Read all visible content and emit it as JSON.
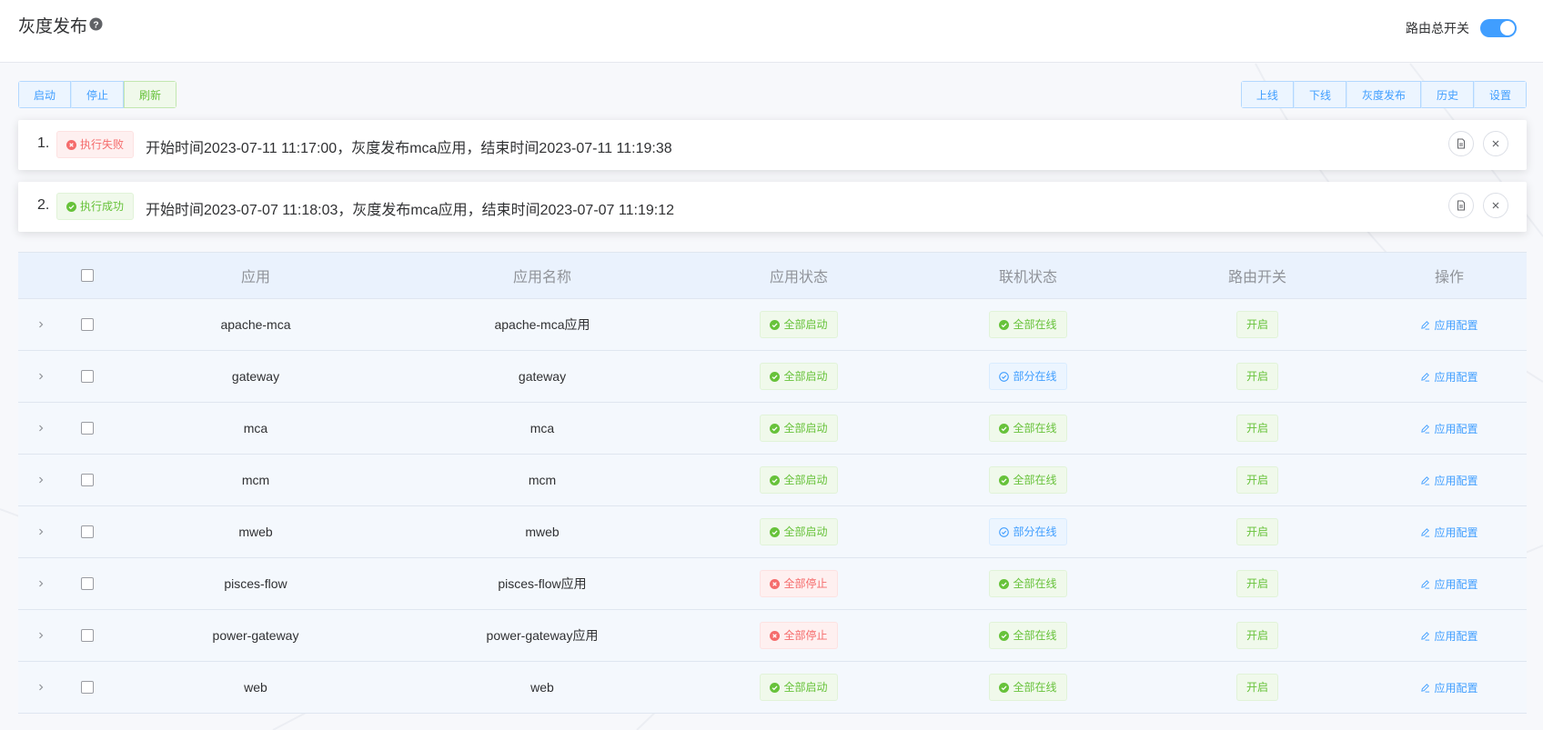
{
  "header": {
    "title": "灰度发布",
    "route_switch_label": "路由总开关",
    "route_switch_on": true
  },
  "toolbar_left": [
    "启动",
    "停止",
    "刷新"
  ],
  "toolbar_right": [
    "上线",
    "下线",
    "灰度发布",
    "历史",
    "设置"
  ],
  "tasks": [
    {
      "index": "1.",
      "status": "执行失败",
      "status_type": "danger",
      "text": "开始时间2023-07-11 11:17:00，灰度发布mca应用，结束时间2023-07-11 11:19:38"
    },
    {
      "index": "2.",
      "status": "执行成功",
      "status_type": "success",
      "text": "开始时间2023-07-07 11:18:03，灰度发布mca应用，结束时间2023-07-07 11:19:12"
    }
  ],
  "table": {
    "columns": [
      "应用",
      "应用名称",
      "应用状态",
      "联机状态",
      "路由开关",
      "操作"
    ],
    "rows": [
      {
        "app": "apache-mca",
        "name": "apache-mca应用",
        "status": "全部启动",
        "status_type": "success",
        "online": "全部在线",
        "online_type": "success",
        "route": "开启",
        "op": "应用配置"
      },
      {
        "app": "gateway",
        "name": "gateway",
        "status": "全部启动",
        "status_type": "success",
        "online": "部分在线",
        "online_type": "info",
        "route": "开启",
        "op": "应用配置"
      },
      {
        "app": "mca",
        "name": "mca",
        "status": "全部启动",
        "status_type": "success",
        "online": "全部在线",
        "online_type": "success",
        "route": "开启",
        "op": "应用配置"
      },
      {
        "app": "mcm",
        "name": "mcm",
        "status": "全部启动",
        "status_type": "success",
        "online": "全部在线",
        "online_type": "success",
        "route": "开启",
        "op": "应用配置"
      },
      {
        "app": "mweb",
        "name": "mweb",
        "status": "全部启动",
        "status_type": "success",
        "online": "部分在线",
        "online_type": "info",
        "route": "开启",
        "op": "应用配置"
      },
      {
        "app": "pisces-flow",
        "name": "pisces-flow应用",
        "status": "全部停止",
        "status_type": "danger",
        "online": "全部在线",
        "online_type": "success",
        "route": "开启",
        "op": "应用配置"
      },
      {
        "app": "power-gateway",
        "name": "power-gateway应用",
        "status": "全部停止",
        "status_type": "danger",
        "online": "全部在线",
        "online_type": "success",
        "route": "开启",
        "op": "应用配置"
      },
      {
        "app": "web",
        "name": "web",
        "status": "全部启动",
        "status_type": "success",
        "online": "全部在线",
        "online_type": "success",
        "route": "开启",
        "op": "应用配置"
      }
    ]
  },
  "colors": {
    "primary": "#409eff",
    "success": "#67c23a",
    "danger": "#f56c6c"
  }
}
